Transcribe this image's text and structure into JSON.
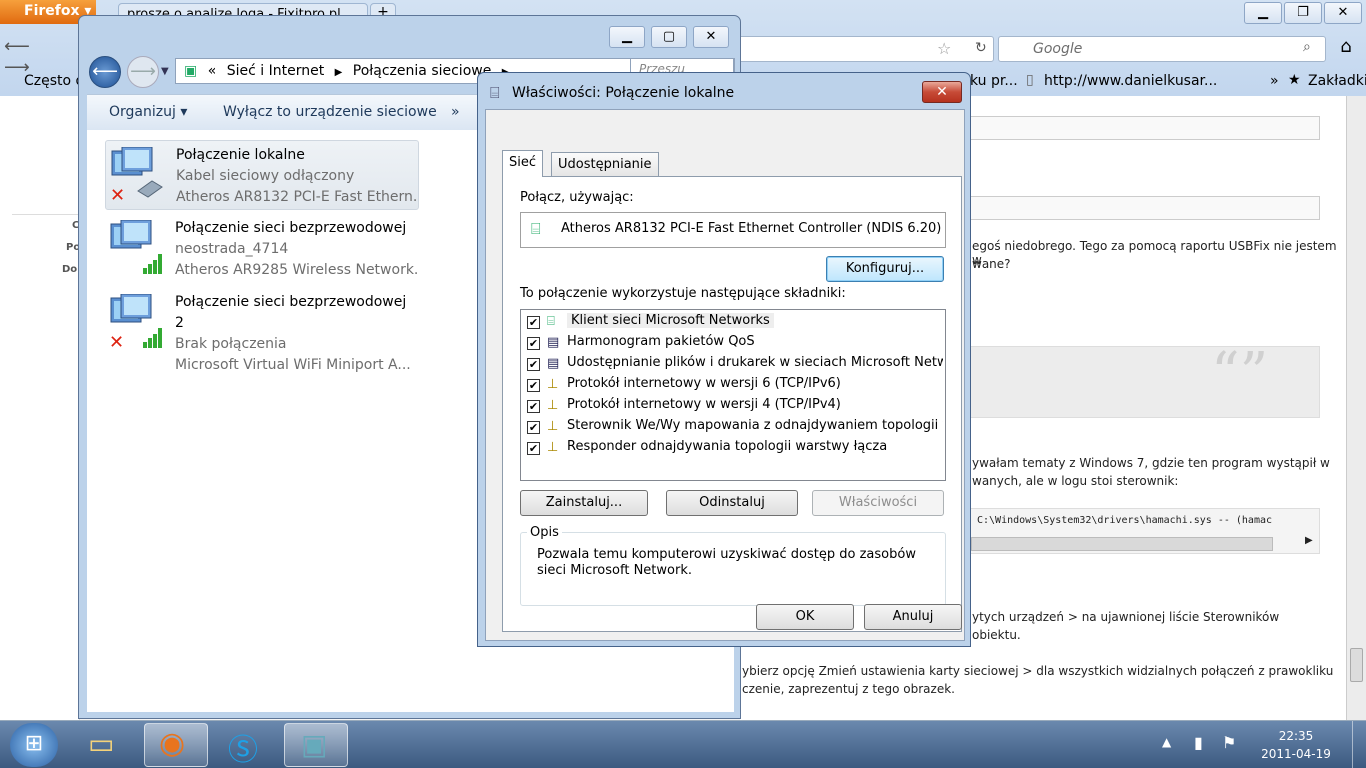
{
  "firefox": {
    "menu_label": "Firefox",
    "tab_title": "prosze o analize loga - Fixitpro.pl",
    "search_placeholder": "Google",
    "bookmarks": {
      "often": "Często o",
      "item1": "ku pr...",
      "item2": "http://www.danielkusar...",
      "more": "»",
      "bookmarks_label": "Zakładki"
    },
    "page_text": {
      "p1a": "egoś niedobrego. Tego za pomocą raportu USBFix nie jestem w",
      "p1b": "wane?",
      "p2a": "ywałam tematy z Windows 7, gdzie ten program wystąpił w",
      "p2b": "wanych, ale w logu stoi sterownik:",
      "code": "C:\\Windows\\System32\\drivers\\hamachi.sys -- (hamac",
      "p3a": "ytych urządzeń > na ujawnionej liście Sterowników",
      "p3b": "obiektu.",
      "p4a": "ybierz opcję Zmień ustawienia karty sieciowej > dla wszystkich widzialnych połączeń z prawokliku",
      "p4b": "czenie, zaprezentuj z tego obrazek."
    },
    "left_strip": [
      "C",
      "Po",
      "Do"
    ]
  },
  "explorer": {
    "breadcrumb_sep": "«",
    "crumb1": "Sieć i Internet",
    "crumb2": "Połączenia sieciowe",
    "search_placeholder": "Przeszu",
    "toolbar": {
      "organize": "Organizuj",
      "disable": "Wyłącz to urządzenie sieciowe",
      "more": "»"
    },
    "connections": [
      {
        "name": "Połączenie lokalne",
        "status": "Kabel sieciowy odłączony",
        "device": "Atheros AR8132 PCI-E Fast Ethern..."
      },
      {
        "name": "Połączenie sieci bezprzewodowej",
        "status": "neostrada_4714",
        "device": "Atheros AR9285 Wireless Network..."
      },
      {
        "name": "Połączenie sieci bezprzewodowej 2",
        "status": "Brak połączenia",
        "device": "Microsoft Virtual WiFi Miniport A..."
      }
    ]
  },
  "dialog": {
    "title": "Właściwości: Połączenie lokalne",
    "close": "✕",
    "tabs": [
      "Sieć",
      "Udostępnianie"
    ],
    "connect_using_label": "Połącz, używając:",
    "adapter": "Atheros AR8132 PCI-E Fast Ethernet Controller (NDIS 6.20)",
    "configure_button": "Konfiguruj...",
    "components_label": "To połączenie wykorzystuje następujące składniki:",
    "components": [
      "Klient sieci Microsoft Networks",
      "Harmonogram pakietów QoS",
      "Udostępnianie plików i drukarek w sieciach Microsoft Networks",
      "Protokół internetowy w wersji 6 (TCP/IPv6)",
      "Protokół internetowy w wersji 4 (TCP/IPv4)",
      "Sterownik We/Wy mapowania z odnajdywaniem topologii war...",
      "Responder odnajdywania topologii warstwy łącza"
    ],
    "install_button": "Zainstaluj...",
    "uninstall_button": "Odinstaluj",
    "properties_button": "Właściwości",
    "description_label": "Opis",
    "description": "Pozwala temu komputerowi uzyskiwać dostęp do zasobów sieci Microsoft Network.",
    "ok_button": "OK",
    "cancel_button": "Anuluj"
  },
  "taskbar": {
    "time": "22:35",
    "date": "2011-04-19"
  }
}
